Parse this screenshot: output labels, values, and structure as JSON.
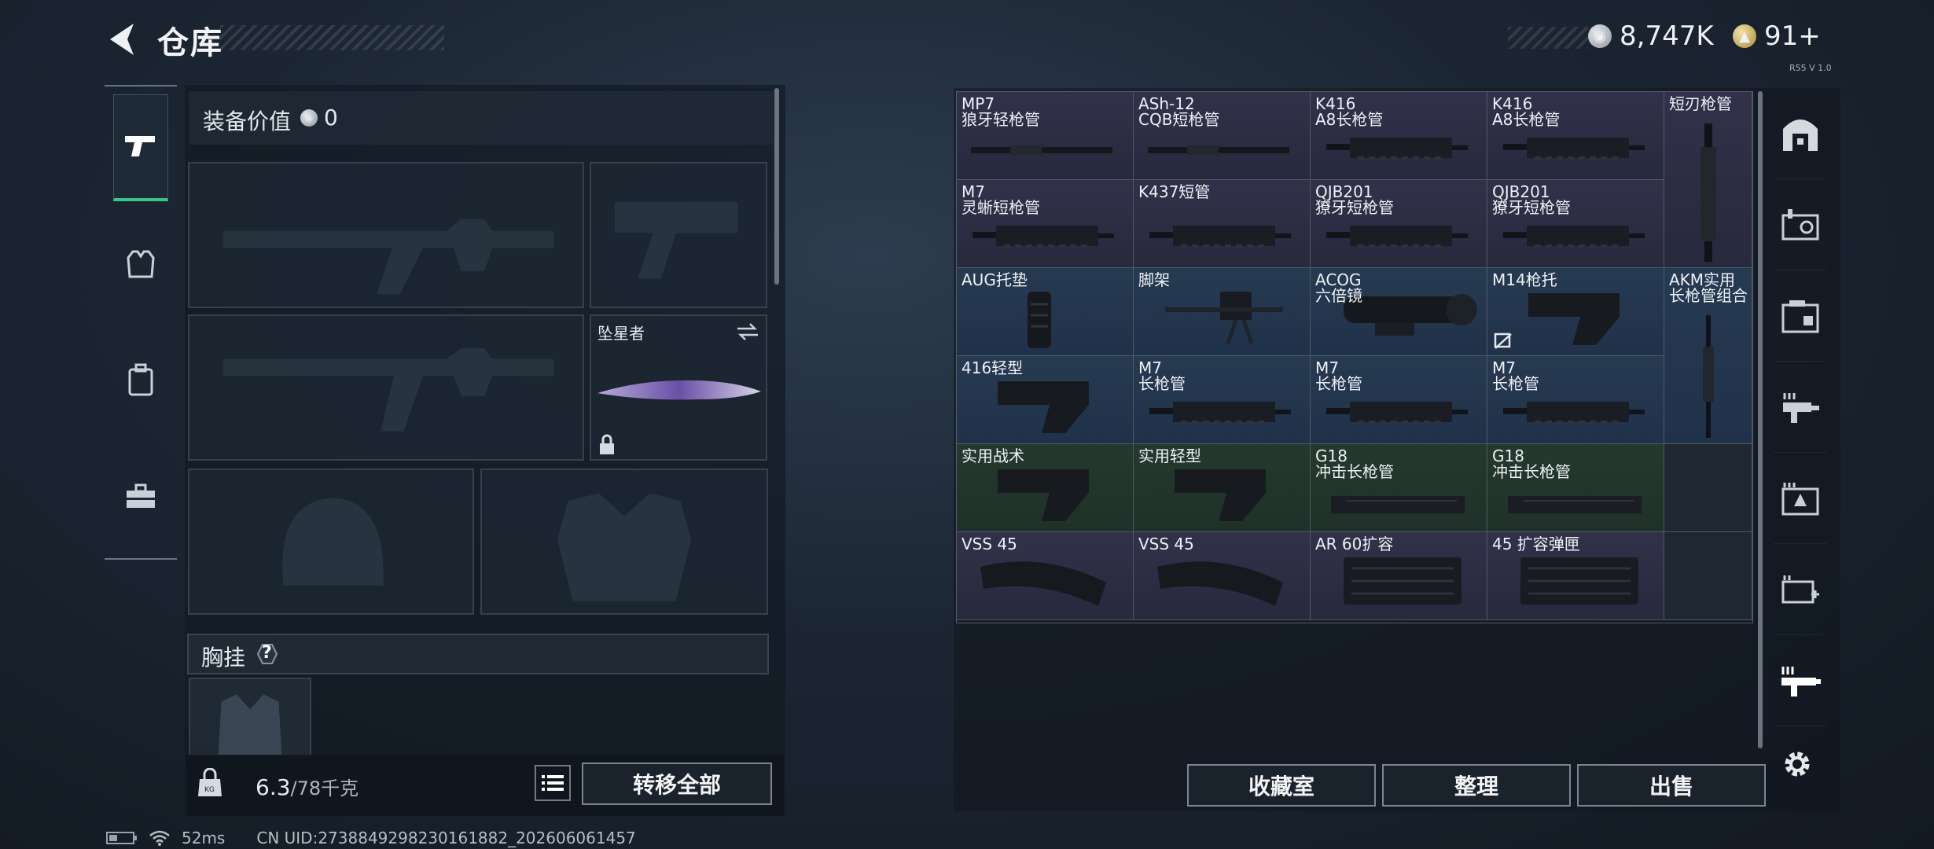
{
  "header": {
    "title": "仓库",
    "back_icon": "back-arrow-icon"
  },
  "currency": {
    "silver_value": "8,747K",
    "gold_value": "91+"
  },
  "version": "R55 V 1.0",
  "loadout": {
    "value_label": "装备价值",
    "value": "0",
    "melee_name": "坠星者",
    "chest_label": "胸挂",
    "chest_help": "?",
    "weight_current": "6.3",
    "weight_max": "/78千克",
    "transfer_all": "转移全部"
  },
  "grid": {
    "rows": [
      [
        {
          "l1": "MP7",
          "l2": "狼牙轻枪管",
          "bg": "purple"
        },
        {
          "l1": "ASh-12",
          "l2": "CQB短枪管",
          "bg": "purple"
        },
        {
          "l1": "K416",
          "l2": "A8长枪管",
          "bg": "purple"
        },
        {
          "l1": "K416",
          "l2": "A8长枪管",
          "bg": "purple"
        }
      ],
      [
        {
          "l1": "M7",
          "l2": "灵蜥短枪管",
          "bg": "purple"
        },
        {
          "l1": "K437短管",
          "l2": "",
          "bg": "purple"
        },
        {
          "l1": "QJB201",
          "l2": "獠牙短枪管",
          "bg": "purple"
        },
        {
          "l1": "QJB201",
          "l2": "獠牙短枪管",
          "bg": "purple"
        }
      ],
      [
        {
          "l1": "AUG托垫",
          "l2": "",
          "bg": "blue"
        },
        {
          "l1": "脚架",
          "l2": "",
          "bg": "blue"
        },
        {
          "l1": "ACOG",
          "l2": "六倍镜",
          "bg": "blue"
        },
        {
          "l1": "M14枪托",
          "l2": "",
          "bg": "blue"
        }
      ],
      [
        {
          "l1": "416轻型",
          "l2": "",
          "bg": "blue"
        },
        {
          "l1": "M7",
          "l2": "长枪管",
          "bg": "blue"
        },
        {
          "l1": "M7",
          "l2": "长枪管",
          "bg": "blue"
        },
        {
          "l1": "M7",
          "l2": "长枪管",
          "bg": "blue"
        }
      ],
      [
        {
          "l1": "实用战术",
          "l2": "",
          "bg": "green"
        },
        {
          "l1": "实用轻型",
          "l2": "",
          "bg": "green"
        },
        {
          "l1": "G18",
          "l2": "冲击长枪管",
          "bg": "green"
        },
        {
          "l1": "G18",
          "l2": "冲击长枪管",
          "bg": "green"
        }
      ],
      [
        {
          "l1": "VSS 45",
          "l2": "",
          "bg": "purple"
        },
        {
          "l1": "VSS 45",
          "l2": "",
          "bg": "purple"
        },
        {
          "l1": "AR 60扩容",
          "l2": "",
          "bg": "purple"
        },
        {
          "l1": "45 扩容弹匣",
          "l2": "",
          "bg": "purple"
        }
      ]
    ],
    "tall_short_blade": {
      "l1": "短刃枪管"
    },
    "tall_akm": {
      "l1": "AKM实用",
      "l2": "长枪管组合"
    }
  },
  "actions": {
    "collection": "收藏室",
    "tidy": "整理",
    "sell": "出售"
  },
  "status": {
    "ping": "52ms",
    "uid": "CN UID:2738849298230161882_202606061457"
  },
  "colors": {
    "accent_green": "#39c58a",
    "rarity_purple": "#2d2e45",
    "rarity_blue": "#23364d",
    "rarity_green": "#22352c"
  }
}
